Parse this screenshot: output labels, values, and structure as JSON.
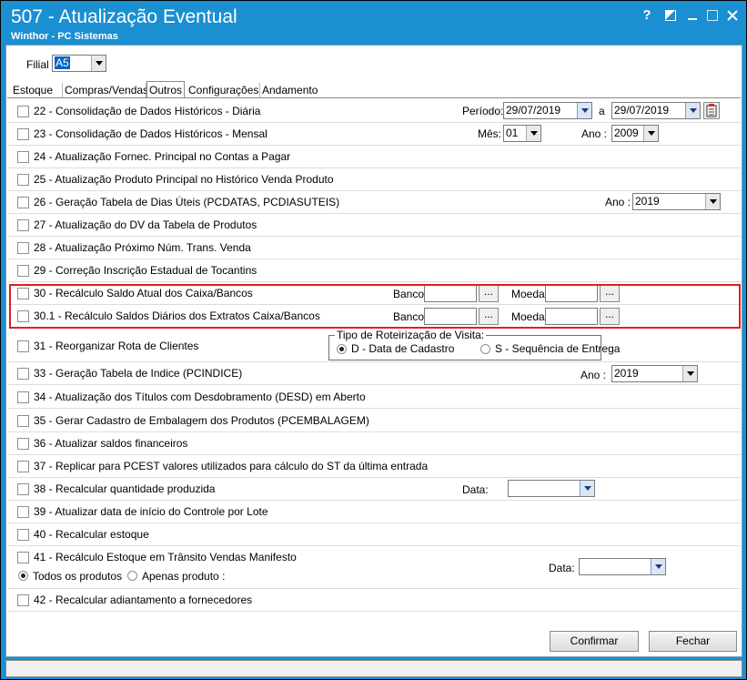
{
  "window": {
    "title": "507 - Atualização Eventual",
    "subtitle": "Winthor - PC Sistemas",
    "help_glyph": "?",
    "icons": [
      "help-icon",
      "restore-icon",
      "minimize-icon",
      "maximize-icon",
      "close-icon"
    ]
  },
  "filial": {
    "label": "Filial",
    "value": "A5"
  },
  "tabs": [
    "Estoque",
    "Compras/Vendas",
    "Outros",
    "Configurações",
    "Andamento"
  ],
  "active_tab": "Outros",
  "options": [
    {
      "id": "22",
      "label": "22 - Consolidação de Dados Históricos - Diária"
    },
    {
      "id": "23",
      "label": "23 - Consolidação de Dados Históricos - Mensal"
    },
    {
      "id": "24",
      "label": "24 - Atualização Fornec. Principal no Contas a Pagar"
    },
    {
      "id": "25",
      "label": "25 - Atualização Produto Principal no Histórico Venda Produto"
    },
    {
      "id": "26",
      "label": "26 - Geração Tabela de Dias Úteis (PCDATAS, PCDIASUTEIS)"
    },
    {
      "id": "27",
      "label": "27 - Atualização do DV da Tabela de Produtos"
    },
    {
      "id": "28",
      "label": "28 - Atualização Próximo Núm. Trans. Venda"
    },
    {
      "id": "29",
      "label": "29 - Correção Inscrição Estadual de Tocantins"
    },
    {
      "id": "30",
      "label": "30 - Recálculo Saldo Atual dos Caixa/Bancos"
    },
    {
      "id": "30_1",
      "label": "30.1 - Recálculo Saldos Diários dos Extratos Caixa/Bancos"
    },
    {
      "id": "31",
      "label": "31 - Reorganizar Rota de Clientes"
    },
    {
      "id": "33",
      "label": "33 - Geração Tabela de Indice (PCINDICE)"
    },
    {
      "id": "34",
      "label": "34 - Atualização dos Títulos com Desdobramento (DESD) em Aberto"
    },
    {
      "id": "35",
      "label": "35 - Gerar Cadastro de Embalagem dos Produtos (PCEMBALAGEM)"
    },
    {
      "id": "36",
      "label": "36 - Atualizar saldos financeiros"
    },
    {
      "id": "37",
      "label": "37 - Replicar para PCEST valores utilizados para cálculo do ST da última entrada"
    },
    {
      "id": "38",
      "label": "38 - Recalcular quantidade produzida"
    },
    {
      "id": "39",
      "label": "39 - Atualizar data de início do Controle por Lote"
    },
    {
      "id": "40",
      "label": "40 - Recalcular estoque"
    },
    {
      "id": "41",
      "label": "41 - Recálculo Estoque em Trânsito Vendas Manifesto"
    },
    {
      "id": "42",
      "label": "42 - Recalcular adiantamento a fornecedores"
    }
  ],
  "opt22": {
    "periodo_label": "Período:",
    "date_from": "29/07/2019",
    "a_label": "a",
    "date_to": "29/07/2019"
  },
  "opt23": {
    "mes_label": "Mês:",
    "mes_value": "01",
    "ano_label": "Ano :",
    "ano_value": "2009"
  },
  "opt26": {
    "ano_label": "Ano :",
    "ano_value": "2019"
  },
  "opt30": {
    "banco_label": "Banco",
    "banco_value": "",
    "moeda_label": "Moeda",
    "moeda_value": "",
    "dots": "..."
  },
  "opt30_1": {
    "banco_label": "Banco",
    "banco_value": "",
    "moeda_label": "Moeda",
    "moeda_value": "",
    "dots": "..."
  },
  "opt31": {
    "group_title": "Tipo de Roteirização de Visita:",
    "radio_d": "D - Data de Cadastro",
    "radio_s": "S - Sequência de Entrega",
    "selected": "D"
  },
  "opt33": {
    "ano_label": "Ano :",
    "ano_value": "2019"
  },
  "opt38": {
    "data_label": "Data:",
    "data_value": ""
  },
  "opt41": {
    "radio_todos": "Todos os produtos",
    "radio_apenas": "Apenas produto :",
    "selected": "todos",
    "data_label": "Data:",
    "data_value": ""
  },
  "buttons": {
    "confirmar": "Confirmar",
    "fechar": "Fechar"
  }
}
